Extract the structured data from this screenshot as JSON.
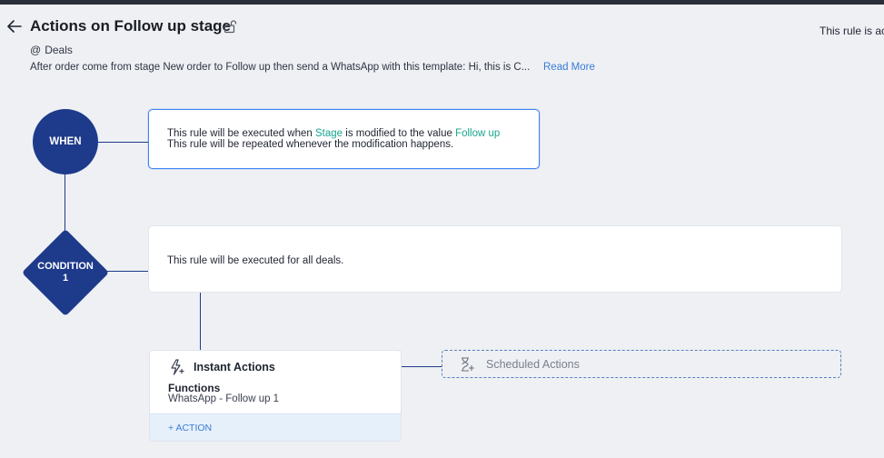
{
  "header": {
    "title": "Actions on Follow up stage",
    "status_text": "This rule is active",
    "module": "Deals",
    "module_prefix": "@",
    "description": "After order come from stage New order to Follow up then send a WhatsApp with this template: Hi, this is C...",
    "read_more": "Read More"
  },
  "when": {
    "label": "WHEN",
    "line1_prefix": "This rule will be executed when ",
    "line1_field": "Stage",
    "line1_middle": " is modified to the value ",
    "line1_value": "Follow up",
    "line2": "This rule will be repeated whenever the modification happens."
  },
  "condition": {
    "label": "CONDITION",
    "number": "1",
    "text": "This rule will be executed for all deals."
  },
  "instant": {
    "title": "Instant Actions",
    "functions_label": "Functions",
    "function_value": "WhatsApp - Follow up 1",
    "add_action": "+ ACTION"
  },
  "scheduled": {
    "label": "Scheduled Actions"
  },
  "icons": {
    "back": "arrow-left-icon",
    "lock": "unlock-icon",
    "instant": "lightning-icon",
    "scheduled": "hourglass-icon"
  },
  "colors": {
    "node": "#1e3a8a",
    "highlight": "#1aa58f",
    "link": "#3a7bd5",
    "active_border": "#3b82f6"
  }
}
